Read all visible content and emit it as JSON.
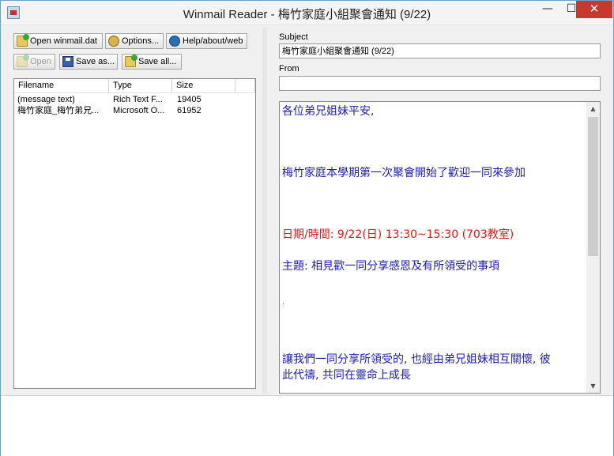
{
  "window": {
    "title": "Winmail Reader - 梅竹家庭小組聚會通知 (9/22)",
    "controls": {
      "minimize": "—",
      "maximize": "☐",
      "close": "✕"
    }
  },
  "toolbar": {
    "open_winmail_label": "Open winmail.dat",
    "options_label": "Options...",
    "help_label": "Help/about/web",
    "open_label": "Open",
    "save_as_label": "Save as...",
    "save_all_label": "Save all..."
  },
  "file_list": {
    "columns": {
      "filename": "Filename",
      "type": "Type",
      "size": "Size"
    },
    "rows": [
      {
        "filename": "(message text)",
        "type": "Rich Text F...",
        "size": "19405"
      },
      {
        "filename": "梅竹家庭_梅竹弟兄...",
        "type": "Microsoft O...",
        "size": "61952"
      }
    ]
  },
  "message": {
    "subject_label": "Subject",
    "subject_value": "梅竹家庭小組聚會通知 (9/22)",
    "from_label": "From",
    "from_value": "",
    "body_lines": [
      "各位弟兄姐妹平安,",
      "梅竹家庭本學期第一次聚會開始了歡迎一同來參加",
      "日期/時間: 9/22(日) 13:30~15:30 (703教室)",
      "主題: 相見歡一同分享感恩及有所領受的事項",
      ".",
      "讓我們一同分享所領受的, 也經由弟兄姐妹相互關懷, 彼",
      "此代禱, 共同在靈命上成長"
    ]
  },
  "colors": {
    "body_text": "#1c1cb4",
    "highlight_text": "#e01818",
    "close_button": "#c7392d"
  },
  "icons": {
    "app": "winmail-app-icon",
    "open_winmail": "folder-open-icon",
    "options": "options-gear-icon",
    "help": "help-globe-icon",
    "open": "folder-open-icon",
    "save_as": "floppy-disk-icon",
    "save_all": "folder-save-icon"
  }
}
